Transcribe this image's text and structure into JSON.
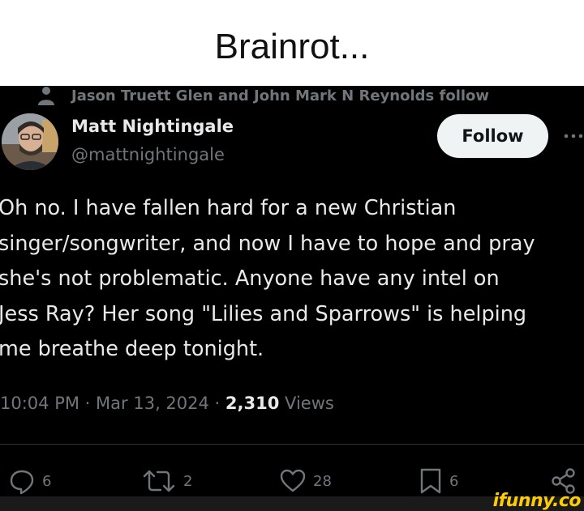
{
  "meme": {
    "title": "Brainrot..."
  },
  "tweet": {
    "social_context": "Jason Truett Glen and John Mark N Reynolds follow",
    "author": {
      "display_name": "Matt Nightingale",
      "handle": "@mattnightingale"
    },
    "follow_label": "Follow",
    "body_lines": [
      "Oh no. I have fallen hard for a new Christian",
      "singer/songwriter, and now I have to hope and pray",
      "she's not problematic. Anyone have any intel on",
      "Jess Ray? Her song \"Lilies and Sparrows\" is helping",
      "me breathe deep tonight."
    ],
    "time": "10:04 PM",
    "date": "Mar 13, 2024",
    "separator": "·",
    "views_count": "2,310",
    "views_label": "Views",
    "actions": {
      "replies": "6",
      "reposts": "2",
      "likes": "28",
      "bookmarks": "6"
    }
  },
  "watermark": "ifunny.co",
  "colors": {
    "background": "#000000",
    "text": "#e7e9ea",
    "secondary": "#71767b",
    "follow_bg": "#eff3f4",
    "watermark": "#ffcc00"
  }
}
